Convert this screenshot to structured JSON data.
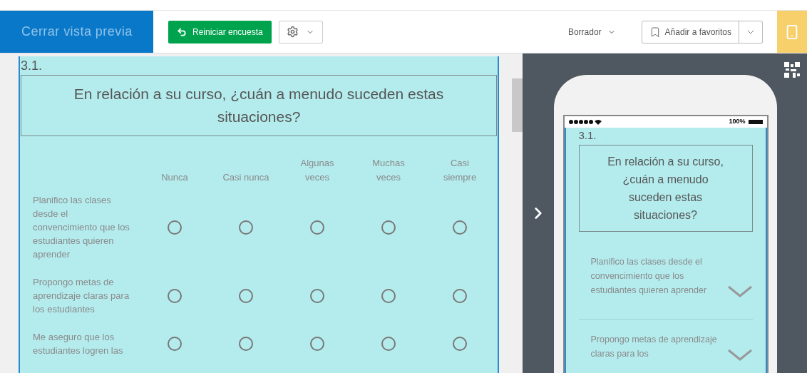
{
  "header": {
    "close_preview": "Cerrar vista previa",
    "restart_button": "Reiniciar encuesta",
    "status": "Borrador",
    "favorites_button": "Añadir a favoritos"
  },
  "question": {
    "number": "3.1.",
    "title": "En relación a su curso, ¿cuán a menudo suceden estas situaciones?",
    "columns": [
      "Nunca",
      "Casi nunca",
      "Algunas veces",
      "Muchas veces",
      "Casi siempre"
    ],
    "rows": [
      {
        "label": "Planifico las clases desde el convencimiento que los estudiantes quieren aprender",
        "choices": [
          {
            "selected": false
          },
          {
            "selected": false
          },
          {
            "selected": false
          },
          {
            "selected": false
          },
          {
            "selected": false
          }
        ]
      },
      {
        "label": "Propongo metas de aprendizaje claras para los estudiantes",
        "choices": [
          {
            "selected": false
          },
          {
            "selected": false
          },
          {
            "selected": false
          },
          {
            "selected": false
          },
          {
            "selected": false
          }
        ]
      },
      {
        "label": "Me aseguro que los estudiantes logren las",
        "choices": [
          {
            "selected": false
          },
          {
            "selected": false
          },
          {
            "selected": false
          },
          {
            "selected": false
          },
          {
            "selected": false
          }
        ]
      }
    ]
  },
  "mobile_preview": {
    "battery": "100%",
    "number": "3.1.",
    "title": "En relación a su curso, ¿cuán a menudo suceden estas situaciones?",
    "rows": [
      {
        "label": "Planifico las clases desde el convencimiento que los estudiantes quieren aprender",
        "expanded": false
      },
      {
        "label": "Propongo metas de aprendizaje claras para los",
        "expanded": false
      }
    ]
  }
}
